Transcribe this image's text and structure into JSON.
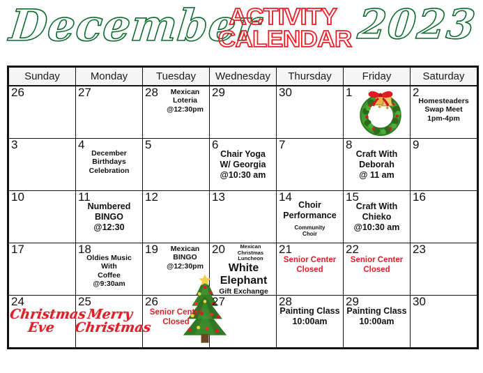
{
  "title": {
    "month": "December",
    "activity": "ACTIVITY",
    "calendar": "CALENDAR",
    "year": "2023",
    "month_color": "#0b6b2e",
    "activity_color": "#ee1c25",
    "year_color": "#0b6b2e"
  },
  "weekday_headers": [
    "Sunday",
    "Monday",
    "Tuesday",
    "Wednesday",
    "Thursday",
    "Friday",
    "Saturday"
  ],
  "colors": {
    "grid_line": "#111111",
    "header_bg": "#f5f5f5",
    "closed_red": "#e02029",
    "script_red": "#e02029"
  },
  "weeks": [
    {
      "days": [
        {
          "num": "26",
          "event": ""
        },
        {
          "num": "27",
          "event": ""
        },
        {
          "num": "28",
          "event": "Mexican\nLoteria\n@12:30pm",
          "inline": true
        },
        {
          "num": "29",
          "event": ""
        },
        {
          "num": "30",
          "event": ""
        },
        {
          "num": "1",
          "event": "",
          "art": "wreath-icon"
        },
        {
          "num": "2",
          "event": "Homesteaders\nSwap Meet\n1pm-4pm"
        }
      ]
    },
    {
      "days": [
        {
          "num": "3",
          "event": ""
        },
        {
          "num": "4",
          "event": "December\nBirthdays\nCelebration"
        },
        {
          "num": "5",
          "event": ""
        },
        {
          "num": "6",
          "event": "Chair Yoga\nW/ Georgia\n@10:30 am",
          "big": true
        },
        {
          "num": "7",
          "event": ""
        },
        {
          "num": "8",
          "event": "Craft With\nDeborah\n@ 11 am",
          "big": true
        },
        {
          "num": "9",
          "event": ""
        }
      ]
    },
    {
      "days": [
        {
          "num": "10",
          "event": ""
        },
        {
          "num": "11",
          "event": "Numbered\nBINGO\n@12:30",
          "big": true
        },
        {
          "num": "12",
          "event": ""
        },
        {
          "num": "13",
          "event": ""
        },
        {
          "num": "14",
          "event": "Choir\nPerformance",
          "sub": "Community\nChoir",
          "big": true
        },
        {
          "num": "15",
          "event": "Craft With\nChieko\n@10:30 am",
          "big": true
        },
        {
          "num": "16",
          "event": ""
        }
      ]
    },
    {
      "days": [
        {
          "num": "17",
          "event": ""
        },
        {
          "num": "18",
          "event": "Oldies Music\nWith\nCoffee\n@9:30am"
        },
        {
          "num": "19",
          "event": "Mexican\nBINGO\n@12:30pm",
          "inline": true
        },
        {
          "num": "20",
          "top_tiny": "Mexican Christmas\nLuncheon",
          "huge": "White\nElephant",
          "med": "Gift Exchange",
          "inline": true
        },
        {
          "num": "21",
          "closed": "Senior Center\nClosed"
        },
        {
          "num": "22",
          "closed": "Senior Center\nClosed"
        },
        {
          "num": "23",
          "event": ""
        }
      ]
    },
    {
      "days": [
        {
          "num": "24",
          "script": "Christmas\nEve"
        },
        {
          "num": "25",
          "script": "Merry\nChristmas"
        },
        {
          "num": "26",
          "closed": "Senior Center\nClosed",
          "art": "christmas-tree-icon"
        },
        {
          "num": "27",
          "event": ""
        },
        {
          "num": "28",
          "event": "Painting Class\n10:00am",
          "big": true
        },
        {
          "num": "29",
          "event": "Painting Class\n10:00am",
          "big": true
        },
        {
          "num": "30",
          "event": ""
        }
      ]
    }
  ]
}
